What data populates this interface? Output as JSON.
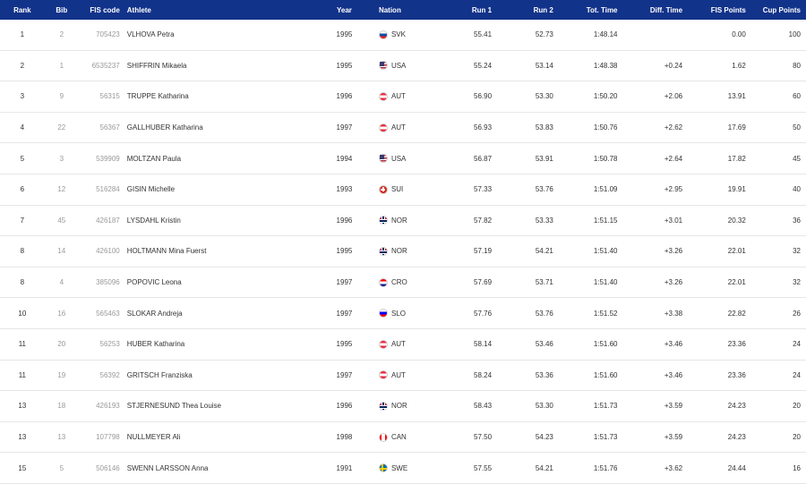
{
  "headers": {
    "rank": "Rank",
    "bib": "Bib",
    "fis_code": "FIS code",
    "athlete": "Athlete",
    "year": "Year",
    "nation": "Nation",
    "run1": "Run 1",
    "run2": "Run 2",
    "tot_time": "Tot. Time",
    "diff_time": "Diff. Time",
    "fis_points": "FIS Points",
    "cup_points": "Cup Points"
  },
  "rows": [
    {
      "rank": "1",
      "bib": "2",
      "fis_code": "705423",
      "athlete": "VLHOVA Petra",
      "year": "1995",
      "nation": "SVK",
      "flag": "svk",
      "run1": "55.41",
      "run2": "52.73",
      "tot_time": "1:48.14",
      "diff_time": "",
      "fis_points": "0.00",
      "cup_points": "100"
    },
    {
      "rank": "2",
      "bib": "1",
      "fis_code": "6535237",
      "athlete": "SHIFFRIN Mikaela",
      "year": "1995",
      "nation": "USA",
      "flag": "usa",
      "run1": "55.24",
      "run2": "53.14",
      "tot_time": "1:48.38",
      "diff_time": "+0.24",
      "fis_points": "1.62",
      "cup_points": "80"
    },
    {
      "rank": "3",
      "bib": "9",
      "fis_code": "56315",
      "athlete": "TRUPPE Katharina",
      "year": "1996",
      "nation": "AUT",
      "flag": "aut",
      "run1": "56.90",
      "run2": "53.30",
      "tot_time": "1:50.20",
      "diff_time": "+2.06",
      "fis_points": "13.91",
      "cup_points": "60"
    },
    {
      "rank": "4",
      "bib": "22",
      "fis_code": "56367",
      "athlete": "GALLHUBER Katharina",
      "year": "1997",
      "nation": "AUT",
      "flag": "aut",
      "run1": "56.93",
      "run2": "53.83",
      "tot_time": "1:50.76",
      "diff_time": "+2.62",
      "fis_points": "17.69",
      "cup_points": "50"
    },
    {
      "rank": "5",
      "bib": "3",
      "fis_code": "539909",
      "athlete": "MOLTZAN Paula",
      "year": "1994",
      "nation": "USA",
      "flag": "usa",
      "run1": "56.87",
      "run2": "53.91",
      "tot_time": "1:50.78",
      "diff_time": "+2.64",
      "fis_points": "17.82",
      "cup_points": "45"
    },
    {
      "rank": "6",
      "bib": "12",
      "fis_code": "516284",
      "athlete": "GISIN Michelle",
      "year": "1993",
      "nation": "SUI",
      "flag": "sui",
      "run1": "57.33",
      "run2": "53.76",
      "tot_time": "1:51.09",
      "diff_time": "+2.95",
      "fis_points": "19.91",
      "cup_points": "40"
    },
    {
      "rank": "7",
      "bib": "45",
      "fis_code": "426187",
      "athlete": "LYSDAHL Kristin",
      "year": "1996",
      "nation": "NOR",
      "flag": "nor",
      "run1": "57.82",
      "run2": "53.33",
      "tot_time": "1:51.15",
      "diff_time": "+3.01",
      "fis_points": "20.32",
      "cup_points": "36"
    },
    {
      "rank": "8",
      "bib": "14",
      "fis_code": "426100",
      "athlete": "HOLTMANN Mina Fuerst",
      "year": "1995",
      "nation": "NOR",
      "flag": "nor",
      "run1": "57.19",
      "run2": "54.21",
      "tot_time": "1:51.40",
      "diff_time": "+3.26",
      "fis_points": "22.01",
      "cup_points": "32"
    },
    {
      "rank": "8",
      "bib": "4",
      "fis_code": "385096",
      "athlete": "POPOVIC Leona",
      "year": "1997",
      "nation": "CRO",
      "flag": "cro",
      "run1": "57.69",
      "run2": "53.71",
      "tot_time": "1:51.40",
      "diff_time": "+3.26",
      "fis_points": "22.01",
      "cup_points": "32"
    },
    {
      "rank": "10",
      "bib": "16",
      "fis_code": "565463",
      "athlete": "SLOKAR Andreja",
      "year": "1997",
      "nation": "SLO",
      "flag": "slo",
      "run1": "57.76",
      "run2": "53.76",
      "tot_time": "1:51.52",
      "diff_time": "+3.38",
      "fis_points": "22.82",
      "cup_points": "26"
    },
    {
      "rank": "11",
      "bib": "20",
      "fis_code": "56253",
      "athlete": "HUBER Katharina",
      "year": "1995",
      "nation": "AUT",
      "flag": "aut",
      "run1": "58.14",
      "run2": "53.46",
      "tot_time": "1:51.60",
      "diff_time": "+3.46",
      "fis_points": "23.36",
      "cup_points": "24"
    },
    {
      "rank": "11",
      "bib": "19",
      "fis_code": "56392",
      "athlete": "GRITSCH Franziska",
      "year": "1997",
      "nation": "AUT",
      "flag": "aut",
      "run1": "58.24",
      "run2": "53.36",
      "tot_time": "1:51.60",
      "diff_time": "+3.46",
      "fis_points": "23.36",
      "cup_points": "24"
    },
    {
      "rank": "13",
      "bib": "18",
      "fis_code": "426193",
      "athlete": "STJERNESUND Thea Louise",
      "year": "1996",
      "nation": "NOR",
      "flag": "nor",
      "run1": "58.43",
      "run2": "53.30",
      "tot_time": "1:51.73",
      "diff_time": "+3.59",
      "fis_points": "24.23",
      "cup_points": "20"
    },
    {
      "rank": "13",
      "bib": "13",
      "fis_code": "107798",
      "athlete": "NULLMEYER Ali",
      "year": "1998",
      "nation": "CAN",
      "flag": "can",
      "run1": "57.50",
      "run2": "54.23",
      "tot_time": "1:51.73",
      "diff_time": "+3.59",
      "fis_points": "24.23",
      "cup_points": "20"
    },
    {
      "rank": "15",
      "bib": "5",
      "fis_code": "506146",
      "athlete": "SWENN LARSSON Anna",
      "year": "1991",
      "nation": "SWE",
      "flag": "swe",
      "run1": "57.55",
      "run2": "54.21",
      "tot_time": "1:51.76",
      "diff_time": "+3.62",
      "fis_points": "24.44",
      "cup_points": "16"
    }
  ],
  "colors": {
    "header_bg": "#12338a",
    "header_text": "#ffffff",
    "row_border": "#e6e6e6",
    "muted_text": "#9a9a9a"
  }
}
